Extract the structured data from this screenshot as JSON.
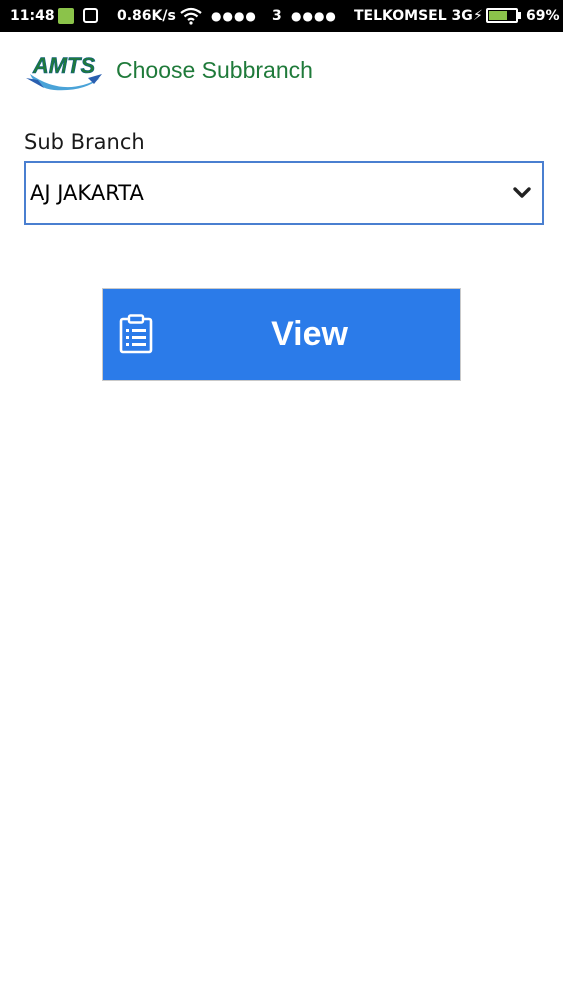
{
  "status_bar": {
    "time": "11:48",
    "net_speed": "0.86K/s",
    "signal_dots_1": "●●●●",
    "sim2_label": "3",
    "signal_dots_2": "●●●●",
    "carrier": "TELKOMSEL 3G",
    "charging_glyph": "⚡",
    "battery_percent": "69%",
    "battery_level": 0.69,
    "icons": [
      "sim-icon",
      "message-icon",
      "wifi-icon",
      "battery-icon"
    ]
  },
  "header": {
    "logo_text": "AMTS",
    "title": "Choose Subbranch"
  },
  "form": {
    "sub_branch_label": "Sub Branch",
    "sub_branch_selected": "AJ JAKARTA"
  },
  "actions": {
    "view_label": "View",
    "view_icon": "clipboard-icon"
  },
  "colors": {
    "title_green": "#1f7a3a",
    "button_blue": "#2b7be9",
    "select_border": "#4a7fd0",
    "battery_green": "#8bc34a"
  }
}
